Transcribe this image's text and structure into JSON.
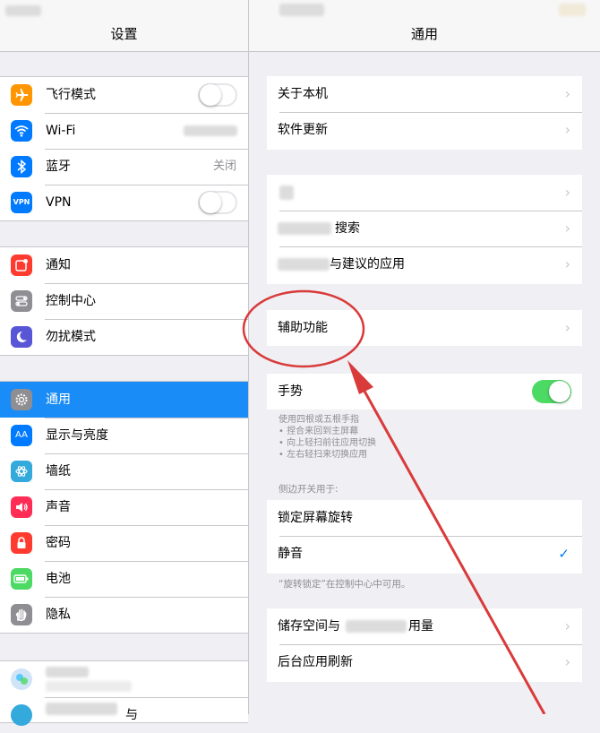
{
  "left_pane": {
    "title": "设置",
    "group1": [
      {
        "label": "飞行模式",
        "icon": "airplane-icon",
        "color": "#ff9500",
        "control": "toggle-off"
      },
      {
        "label": "Wi-Fi",
        "icon": "wifi-icon",
        "color": "#007aff",
        "control": "blurred-value"
      },
      {
        "label": "蓝牙",
        "icon": "bluetooth-icon",
        "color": "#007aff",
        "value": "关闭"
      },
      {
        "label": "VPN",
        "icon": "vpn-icon",
        "color": "#007aff",
        "control": "toggle-off"
      }
    ],
    "group2": [
      {
        "label": "通知",
        "icon": "notifications-icon",
        "color": "#ff3b30"
      },
      {
        "label": "控制中心",
        "icon": "control-center-icon",
        "color": "#8e8e93"
      },
      {
        "label": "勿扰模式",
        "icon": "moon-icon",
        "color": "#5856d6"
      }
    ],
    "group3": [
      {
        "label": "通用",
        "icon": "gear-icon",
        "color": "#8e8e93",
        "selected": true
      },
      {
        "label": "显示与亮度",
        "icon": "display-icon",
        "color": "#007aff"
      },
      {
        "label": "墙纸",
        "icon": "wallpaper-icon",
        "color": "#34aadc"
      },
      {
        "label": "声音",
        "icon": "sound-icon",
        "color": "#ff2d55"
      },
      {
        "label": "密码",
        "icon": "lock-icon",
        "color": "#ff3b30"
      },
      {
        "label": "电池",
        "icon": "battery-icon",
        "color": "#4cd964"
      },
      {
        "label": "隐私",
        "icon": "hand-icon",
        "color": "#8e8e93"
      }
    ],
    "group4": [
      {
        "label": "",
        "icon": "game-center-icon",
        "color": "#d0e4f7"
      },
      {
        "label": "与",
        "icon": "partial-icon",
        "color": "#34aadc"
      }
    ],
    "vpn_icon_text": "VPN",
    "display_icon_text": "AA"
  },
  "right_pane": {
    "title": "通用",
    "group1": [
      {
        "label": "关于本机"
      },
      {
        "label": "软件更新"
      }
    ],
    "group2": [
      {
        "label": ""
      },
      {
        "label": "搜索"
      },
      {
        "label": "与建议的应用"
      }
    ],
    "group3": [
      {
        "label": "辅助功能"
      }
    ],
    "gesture": {
      "label": "手势",
      "on": true
    },
    "gesture_footnote": [
      "使用四根或五根手指",
      "• 捏合来回到主屏幕",
      "• 向上轻扫前往应用切换",
      "• 左右轻扫来切换应用"
    ],
    "side_switch_header": "侧边开关用于:",
    "side_switch": [
      {
        "label": "锁定屏幕旋转",
        "checked": false
      },
      {
        "label": "静音",
        "checked": true
      }
    ],
    "rotation_footnote": "“旋转锁定”在控制中心中可用。",
    "group6": [
      {
        "label_a": "储存空间与",
        "label_b": "用量"
      },
      {
        "label": "后台应用刷新"
      }
    ]
  },
  "annotation": {
    "circle_color": "#d93a3a",
    "arrow_color": "#d93a3a"
  },
  "chevron_glyph": "›",
  "check_glyph": "✓"
}
